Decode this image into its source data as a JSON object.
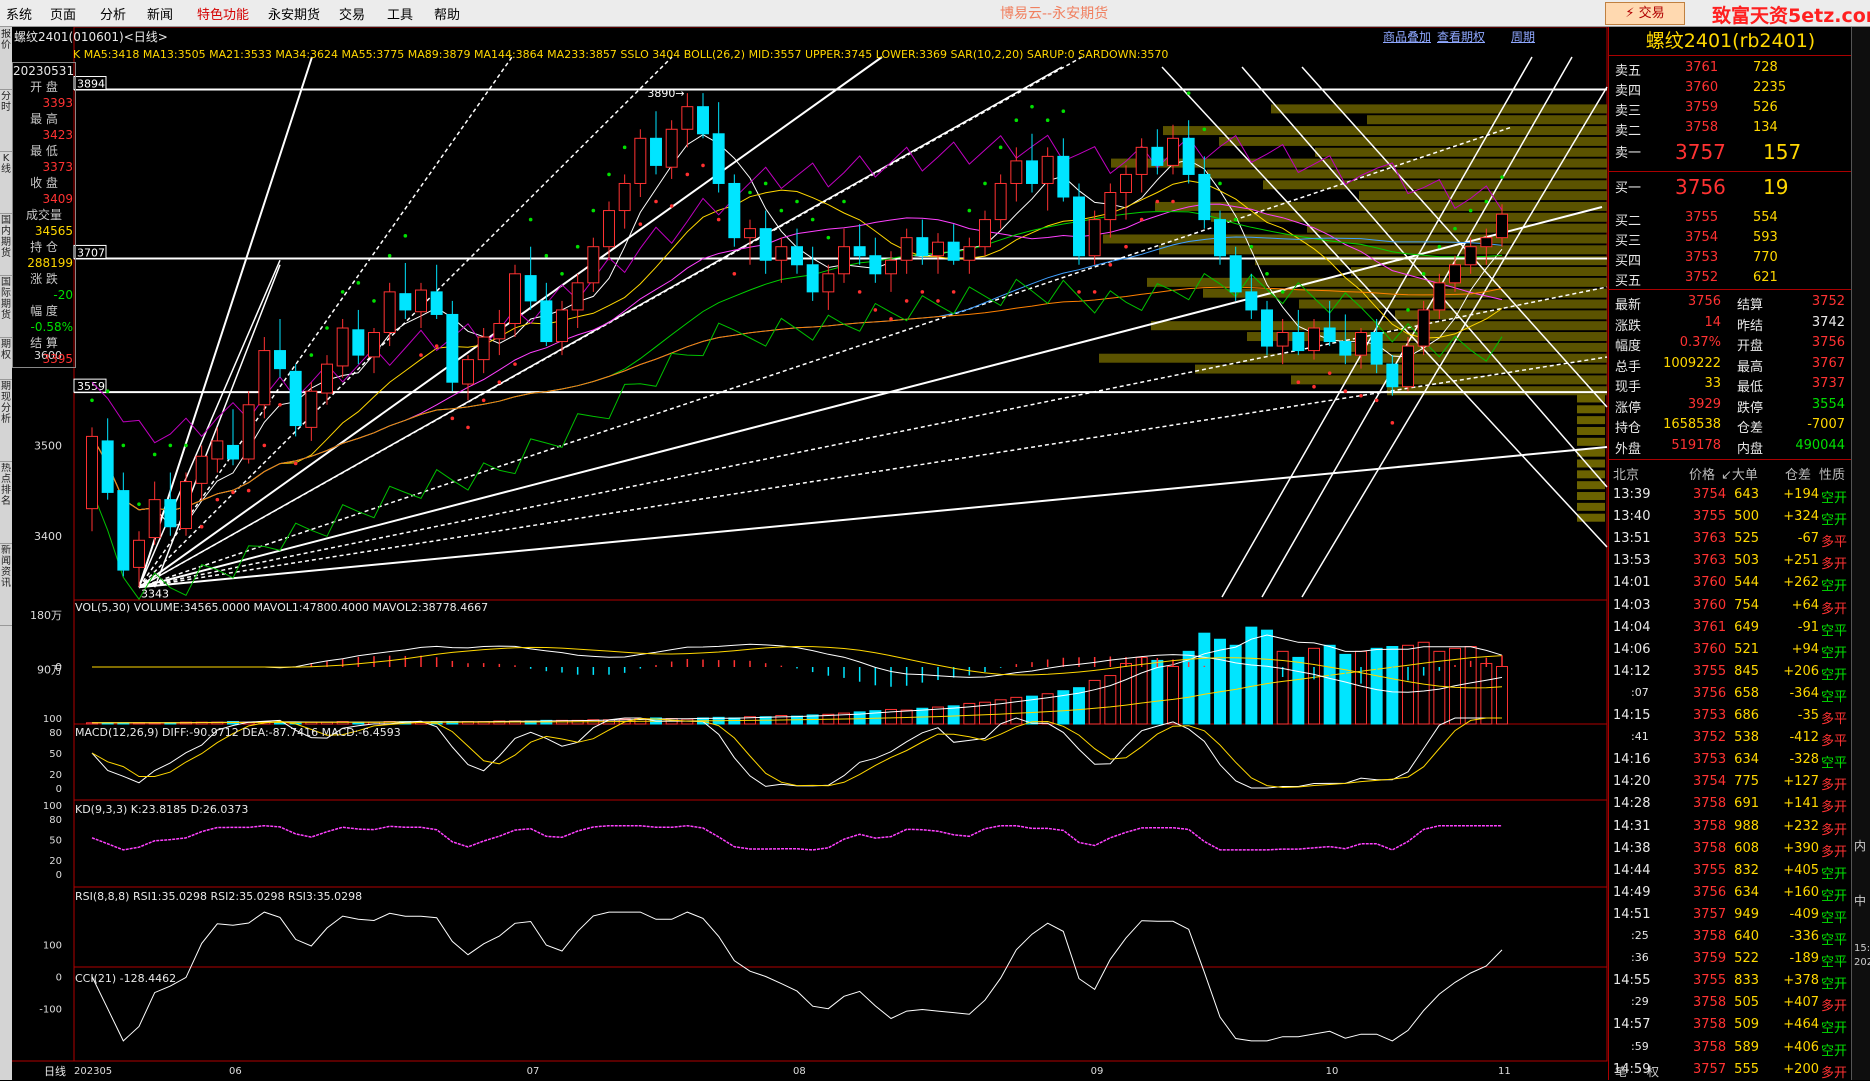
{
  "menu": {
    "items": [
      "系统",
      "页面",
      "分析",
      "新闻",
      "特色功能",
      "永安期货",
      "交易",
      "工具",
      "帮助"
    ],
    "highlight": "特色功能",
    "title": "博易云--永安期货",
    "trade_button": "⚡ 交易",
    "logo_text": "致富天资5etz.com"
  },
  "left_sidebar": [
    "报价",
    "分时",
    "K线",
    "国内期货",
    "国际期货",
    "期权",
    "期现分析",
    "热点排名",
    "新闻资讯"
  ],
  "right_strip": [
    "内",
    "中",
    "15:",
    "202"
  ],
  "chart_data": {
    "type": "candlestick",
    "instrument_code": "螺纹2401(010601)<日线>",
    "period_label": "日线",
    "x_labels": [
      "202305",
      "06",
      "07",
      "08",
      "09",
      "10",
      "11"
    ],
    "price_ticks": [
      3400,
      3500,
      3600
    ],
    "price_range": [
      3330,
      3930
    ],
    "indicator_line": "K  MA5:3418  MA13:3505  MA21:3533  MA34:3624  MA55:3775  MA89:3879  MA144:3864  MA233:3857  SSLO 3404  BOLL(26,2)  MID:3557  UPPER:3745  LOWER:3369  SAR(10,2,20)  SARUP:0  SARDOWN:3570",
    "hlines": [
      3894,
      3707,
      3559
    ],
    "hline_labels": [
      "3894",
      "3707",
      "3559"
    ],
    "annotations": [
      "3890",
      "3343"
    ],
    "candles": [
      [
        3430,
        3520,
        3405,
        3510
      ],
      [
        3505,
        3530,
        3440,
        3448
      ],
      [
        3450,
        3470,
        3355,
        3362
      ],
      [
        3365,
        3405,
        3343,
        3395
      ],
      [
        3398,
        3460,
        3390,
        3440
      ],
      [
        3440,
        3470,
        3400,
        3410
      ],
      [
        3408,
        3470,
        3400,
        3460
      ],
      [
        3458,
        3500,
        3440,
        3488
      ],
      [
        3485,
        3520,
        3470,
        3505
      ],
      [
        3500,
        3540,
        3478,
        3485
      ],
      [
        3485,
        3560,
        3480,
        3545
      ],
      [
        3545,
        3620,
        3530,
        3605
      ],
      [
        3605,
        3640,
        3575,
        3585
      ],
      [
        3582,
        3590,
        3510,
        3522
      ],
      [
        3520,
        3570,
        3505,
        3560
      ],
      [
        3558,
        3600,
        3545,
        3590
      ],
      [
        3588,
        3640,
        3575,
        3630
      ],
      [
        3628,
        3650,
        3590,
        3600
      ],
      [
        3598,
        3630,
        3580,
        3625
      ],
      [
        3625,
        3680,
        3610,
        3670
      ],
      [
        3668,
        3702,
        3640,
        3650
      ],
      [
        3648,
        3680,
        3630,
        3672
      ],
      [
        3670,
        3700,
        3640,
        3645
      ],
      [
        3645,
        3660,
        3560,
        3570
      ],
      [
        3568,
        3600,
        3550,
        3595
      ],
      [
        3595,
        3630,
        3580,
        3620
      ],
      [
        3618,
        3650,
        3600,
        3635
      ],
      [
        3635,
        3700,
        3620,
        3690
      ],
      [
        3688,
        3720,
        3650,
        3660
      ],
      [
        3660,
        3680,
        3610,
        3615
      ],
      [
        3615,
        3660,
        3600,
        3650
      ],
      [
        3650,
        3690,
        3630,
        3680
      ],
      [
        3680,
        3730,
        3670,
        3720
      ],
      [
        3720,
        3770,
        3705,
        3760
      ],
      [
        3760,
        3800,
        3740,
        3790
      ],
      [
        3790,
        3850,
        3775,
        3840
      ],
      [
        3840,
        3870,
        3800,
        3810
      ],
      [
        3808,
        3860,
        3795,
        3850
      ],
      [
        3850,
        3890,
        3830,
        3875
      ],
      [
        3875,
        3890,
        3840,
        3845
      ],
      [
        3845,
        3880,
        3780,
        3790
      ],
      [
        3790,
        3800,
        3720,
        3730
      ],
      [
        3730,
        3750,
        3700,
        3740
      ],
      [
        3740,
        3760,
        3690,
        3705
      ],
      [
        3705,
        3730,
        3680,
        3720
      ],
      [
        3720,
        3740,
        3690,
        3700
      ],
      [
        3700,
        3720,
        3660,
        3670
      ],
      [
        3670,
        3700,
        3650,
        3690
      ],
      [
        3690,
        3740,
        3680,
        3720
      ],
      [
        3720,
        3745,
        3700,
        3710
      ],
      [
        3710,
        3730,
        3680,
        3690
      ],
      [
        3690,
        3715,
        3670,
        3705
      ],
      [
        3705,
        3740,
        3690,
        3730
      ],
      [
        3730,
        3750,
        3700,
        3710
      ],
      [
        3710,
        3735,
        3690,
        3725
      ],
      [
        3725,
        3745,
        3700,
        3705
      ],
      [
        3705,
        3730,
        3690,
        3720
      ],
      [
        3720,
        3760,
        3710,
        3750
      ],
      [
        3750,
        3800,
        3740,
        3790
      ],
      [
        3790,
        3830,
        3770,
        3815
      ],
      [
        3815,
        3845,
        3780,
        3790
      ],
      [
        3790,
        3830,
        3760,
        3820
      ],
      [
        3820,
        3840,
        3770,
        3775
      ],
      [
        3775,
        3790,
        3700,
        3710
      ],
      [
        3710,
        3760,
        3700,
        3750
      ],
      [
        3750,
        3790,
        3730,
        3780
      ],
      [
        3780,
        3810,
        3750,
        3800
      ],
      [
        3800,
        3840,
        3780,
        3830
      ],
      [
        3830,
        3850,
        3800,
        3810
      ],
      [
        3810,
        3855,
        3800,
        3840
      ],
      [
        3840,
        3860,
        3790,
        3800
      ],
      [
        3800,
        3820,
        3740,
        3750
      ],
      [
        3750,
        3760,
        3700,
        3710
      ],
      [
        3710,
        3720,
        3660,
        3670
      ],
      [
        3670,
        3690,
        3640,
        3650
      ],
      [
        3650,
        3660,
        3600,
        3610
      ],
      [
        3610,
        3640,
        3590,
        3625
      ],
      [
        3625,
        3650,
        3600,
        3605
      ],
      [
        3605,
        3640,
        3595,
        3630
      ],
      [
        3630,
        3660,
        3610,
        3615
      ],
      [
        3615,
        3645,
        3590,
        3600
      ],
      [
        3600,
        3630,
        3585,
        3625
      ],
      [
        3625,
        3640,
        3580,
        3590
      ],
      [
        3590,
        3600,
        3555,
        3565
      ],
      [
        3565,
        3620,
        3560,
        3610
      ],
      [
        3610,
        3660,
        3600,
        3650
      ],
      [
        3650,
        3690,
        3640,
        3680
      ],
      [
        3680,
        3710,
        3670,
        3700
      ],
      [
        3700,
        3730,
        3690,
        3720
      ],
      [
        3720,
        3740,
        3700,
        3730
      ],
      [
        3730,
        3767,
        3720,
        3756
      ]
    ],
    "volume_label": "VOL(5,30)  VOLUME:34565.0000  MAVOL1:47800.4000  MAVOL2:38778.4667",
    "volume_ticks": [
      "180万",
      "90万"
    ],
    "volume_values": [
      2,
      2,
      2,
      2,
      2,
      2,
      3,
      3,
      3,
      4,
      3,
      4,
      3,
      3,
      3,
      3,
      4,
      3,
      3,
      4,
      4,
      3,
      4,
      4,
      4,
      4,
      5,
      5,
      5,
      6,
      6,
      6,
      7,
      7,
      8,
      9,
      10,
      9,
      8,
      10,
      11,
      10,
      12,
      12,
      14,
      13,
      15,
      16,
      18,
      20,
      22,
      24,
      23,
      26,
      28,
      30,
      34,
      36,
      40,
      44,
      46,
      50,
      55,
      60,
      72,
      80,
      100,
      110,
      105,
      95,
      120,
      150,
      140,
      130,
      160,
      155,
      120,
      110,
      125,
      130,
      115,
      120,
      125,
      128,
      130,
      135,
      120,
      125,
      128,
      100,
      95
    ],
    "macd_label": "MACD(12,26,9)  DIFF:-90.9712  DEA:-87.7416  MACD:-6.4593",
    "kd_label": "KD(9,3,3)  K:23.8185  D:26.0373",
    "kd_ticks": [
      "100",
      "80",
      "50",
      "20",
      "0"
    ],
    "rsi_label": "RSI(8,8,8)  RSI1:35.0298  RSI2:35.0298  RSI3:35.0298",
    "rsi_ticks": [
      "100",
      "80",
      "50",
      "20",
      "0"
    ],
    "cci_label": "CCI(21)  -128.4462",
    "cci_ticks": [
      "100",
      "0",
      "-100"
    ],
    "overlay_links": [
      "商品叠加",
      "查看期权",
      "周期"
    ]
  },
  "stats": {
    "date": "20230531",
    "open_label": "开  盘",
    "open": "3393",
    "high_label": "最  高",
    "high": "3423",
    "low_label": "最  低",
    "low": "3373",
    "close_label": "收  盘",
    "close": "3409",
    "vol_label": "成交量",
    "vol": "34565",
    "oi_label": "持  仓",
    "oi": "288199",
    "chg_label": "涨  跌",
    "chg": "-20",
    "pct_label": "幅  度",
    "pct": "-0.58%",
    "settle_label": "结  算",
    "settle": "3395"
  },
  "quote": {
    "title": "螺纹2401(rb2401)",
    "asks": [
      {
        "label": "卖五",
        "price": "3761",
        "vol": "728"
      },
      {
        "label": "卖四",
        "price": "3760",
        "vol": "2235"
      },
      {
        "label": "卖三",
        "price": "3759",
        "vol": "526"
      },
      {
        "label": "卖二",
        "price": "3758",
        "vol": "134"
      },
      {
        "label": "卖一",
        "price": "3757",
        "vol": "157"
      }
    ],
    "bids": [
      {
        "label": "买一",
        "price": "3756",
        "vol": "19"
      },
      {
        "label": "买二",
        "price": "3755",
        "vol": "554"
      },
      {
        "label": "买三",
        "price": "3754",
        "vol": "593"
      },
      {
        "label": "买四",
        "price": "3753",
        "vol": "770"
      },
      {
        "label": "买五",
        "price": "3752",
        "vol": "621"
      }
    ],
    "info": [
      {
        "l1": "最新",
        "v1": "3756",
        "c1": "red",
        "l2": "结算",
        "v2": "3752",
        "c2": "red"
      },
      {
        "l1": "涨跌",
        "v1": "14",
        "c1": "red",
        "l2": "昨结",
        "v2": "3742",
        "c2": "white"
      },
      {
        "l1": "幅度",
        "v1": "0.37%",
        "c1": "red",
        "l2": "开盘",
        "v2": "3756",
        "c2": "red"
      },
      {
        "l1": "总手",
        "v1": "1009222",
        "c1": "yellow",
        "l2": "最高",
        "v2": "3767",
        "c2": "red"
      },
      {
        "l1": "现手",
        "v1": "33",
        "c1": "yellow",
        "l2": "最低",
        "v2": "3737",
        "c2": "red"
      },
      {
        "l1": "涨停",
        "v1": "3929",
        "c1": "red",
        "l2": "跌停",
        "v2": "3554",
        "c2": "green"
      },
      {
        "l1": "持仓",
        "v1": "1658538",
        "c1": "yellow",
        "l2": "仓差",
        "v2": "-7007",
        "c2": "yellow"
      },
      {
        "l1": "外盘",
        "v1": "519178",
        "c1": "red",
        "l2": "内盘",
        "v2": "490044",
        "c2": "green"
      }
    ],
    "ts_header": {
      "time": "北京",
      "price": "价格",
      "vol": "↙大单",
      "oi": "仓差",
      "nature": "性质"
    },
    "ticks": [
      {
        "t": "13:39",
        "p": "3754",
        "v": "643",
        "oi": "+194",
        "n": "空开",
        "nc": "green"
      },
      {
        "t": "13:40",
        "p": "3755",
        "v": "500",
        "oi": "+324",
        "n": "空开",
        "nc": "green"
      },
      {
        "t": "13:51",
        "p": "3763",
        "v": "525",
        "oi": "-67",
        "n": "多平",
        "nc": "red"
      },
      {
        "t": "13:53",
        "p": "3763",
        "v": "503",
        "oi": "+251",
        "n": "多开",
        "nc": "red"
      },
      {
        "t": "14:01",
        "p": "3760",
        "v": "544",
        "oi": "+262",
        "n": "空开",
        "nc": "green"
      },
      {
        "t": "14:03",
        "p": "3760",
        "v": "754",
        "oi": "+64",
        "n": "多开",
        "nc": "red"
      },
      {
        "t": "14:04",
        "p": "3761",
        "v": "649",
        "oi": "-91",
        "n": "空平",
        "nc": "green"
      },
      {
        "t": "14:06",
        "p": "3760",
        "v": "521",
        "oi": "+94",
        "n": "空开",
        "nc": "green"
      },
      {
        "t": "14:12",
        "p": "3755",
        "v": "845",
        "oi": "+206",
        "n": "空开",
        "nc": "green"
      },
      {
        "t": ":07",
        "p": "3756",
        "v": "658",
        "oi": "-364",
        "n": "空平",
        "nc": "green"
      },
      {
        "t": "14:15",
        "p": "3753",
        "v": "686",
        "oi": "-35",
        "n": "多平",
        "nc": "red"
      },
      {
        "t": ":41",
        "p": "3752",
        "v": "538",
        "oi": "-412",
        "n": "多平",
        "nc": "red"
      },
      {
        "t": "14:16",
        "p": "3753",
        "v": "634",
        "oi": "-328",
        "n": "空平",
        "nc": "green"
      },
      {
        "t": "14:20",
        "p": "3754",
        "v": "775",
        "oi": "+127",
        "n": "多开",
        "nc": "red"
      },
      {
        "t": "14:28",
        "p": "3758",
        "v": "691",
        "oi": "+141",
        "n": "多开",
        "nc": "red"
      },
      {
        "t": "14:31",
        "p": "3758",
        "v": "988",
        "oi": "+232",
        "n": "多开",
        "nc": "red"
      },
      {
        "t": "14:38",
        "p": "3758",
        "v": "608",
        "oi": "+390",
        "n": "多开",
        "nc": "red"
      },
      {
        "t": "14:44",
        "p": "3755",
        "v": "832",
        "oi": "+405",
        "n": "空开",
        "nc": "green"
      },
      {
        "t": "14:49",
        "p": "3756",
        "v": "634",
        "oi": "+160",
        "n": "空开",
        "nc": "green"
      },
      {
        "t": "14:51",
        "p": "3757",
        "v": "949",
        "oi": "-409",
        "n": "空平",
        "nc": "green"
      },
      {
        "t": ":25",
        "p": "3758",
        "v": "640",
        "oi": "-336",
        "n": "空平",
        "nc": "green"
      },
      {
        "t": ":36",
        "p": "3759",
        "v": "522",
        "oi": "-189",
        "n": "空平",
        "nc": "green"
      },
      {
        "t": "14:55",
        "p": "3755",
        "v": "833",
        "oi": "+378",
        "n": "空开",
        "nc": "green"
      },
      {
        "t": ":29",
        "p": "3758",
        "v": "505",
        "oi": "+407",
        "n": "多开",
        "nc": "red"
      },
      {
        "t": "14:57",
        "p": "3758",
        "v": "509",
        "oi": "+464",
        "n": "空开",
        "nc": "green"
      },
      {
        "t": ":59",
        "p": "3758",
        "v": "589",
        "oi": "+406",
        "n": "空开",
        "nc": "green"
      },
      {
        "t": "14:59",
        "p": "3757",
        "v": "555",
        "oi": "+200",
        "n": "多开",
        "nc": "red"
      }
    ],
    "bottom_tabs": [
      "笔",
      "权"
    ]
  },
  "colors": {
    "up": "#ff3232",
    "down": "#00e5ff",
    "grid": "#b00000",
    "fan": "#ffffff",
    "volbar": "#6b6200"
  }
}
